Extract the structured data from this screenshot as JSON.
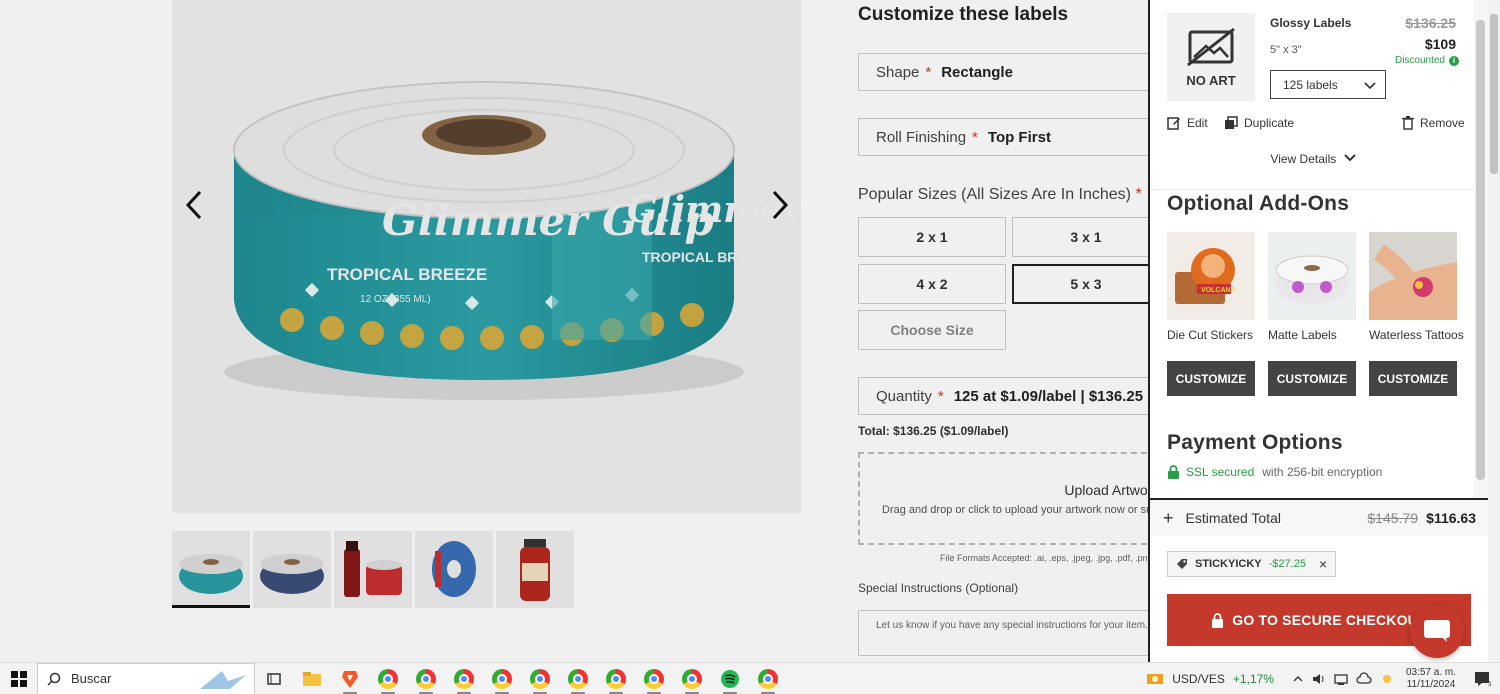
{
  "product": {
    "thumbnails": [
      "thumb-teal-roll",
      "thumb-blue-roll",
      "thumb-bottle-labels",
      "thumb-roll-side",
      "thumb-jar"
    ]
  },
  "form": {
    "title": "Customize these labels",
    "shape": {
      "label": "Shape",
      "value": "Rectangle"
    },
    "roll": {
      "label": "Roll Finishing",
      "value": "Top First"
    },
    "sizes_title": "Popular Sizes (All Sizes Are In Inches)",
    "sizes": [
      "2 x 1",
      "3 x 1",
      "4 x 2",
      "5 x 3"
    ],
    "selected_size": "5 x 3",
    "choose_size": "Choose Size",
    "quantity": {
      "label": "Quantity",
      "value": "125 at $1.09/label | $136.25"
    },
    "total": "Total: $136.25 ($1.09/label)",
    "upload_title": "Upload Artwork (optional)",
    "upload_desc": "Drag and drop or click to upload your artwork now or sub",
    "formats": "File Formats Accepted: .ai, .eps, .jpeg, .jpg, .pdf, .pn",
    "special_label": "Special Instructions (Optional)",
    "special_placeholder": "Let us know if you have any special instructions for your item."
  },
  "cart": {
    "item": {
      "no_art": "NO ART",
      "name": "Glossy Labels",
      "size": "5\" x 3\"",
      "price_old": "$136.25",
      "price_new": "$109",
      "discount_label": "Discounted",
      "quantity": "125 labels",
      "edit": "Edit",
      "duplicate": "Duplicate",
      "remove": "Remove",
      "view_details": "View Details"
    },
    "addons_title": "Optional Add-Ons",
    "addons": [
      {
        "name": "Die Cut Stickers",
        "button": "CUSTOMIZE"
      },
      {
        "name": "Matte Labels",
        "button": "CUSTOMIZE"
      },
      {
        "name": "Waterless Tattoos",
        "button": "CUSTOMIZE"
      }
    ],
    "payment_title": "Payment Options",
    "ssl_label": "SSL secured",
    "ssl_sub": "with 256-bit encryption",
    "estimated_label": "Estimated Total",
    "estimated_old": "$145.79",
    "estimated_new": "$116.63",
    "coupon_code": "STICKYICKY",
    "coupon_amount": "-$27.25",
    "checkout_label": "GO TO SECURE CHECKOUT"
  },
  "taskbar": {
    "search_placeholder": "Buscar",
    "ticker_name": "USD/VES",
    "ticker_change": "+1,17%",
    "time": "03:57 a. m.",
    "date": "11/11/2024"
  },
  "colors": {
    "accent_red": "#c4392b",
    "discount_green": "#2a9d46",
    "teal": "#2a9aa0"
  }
}
